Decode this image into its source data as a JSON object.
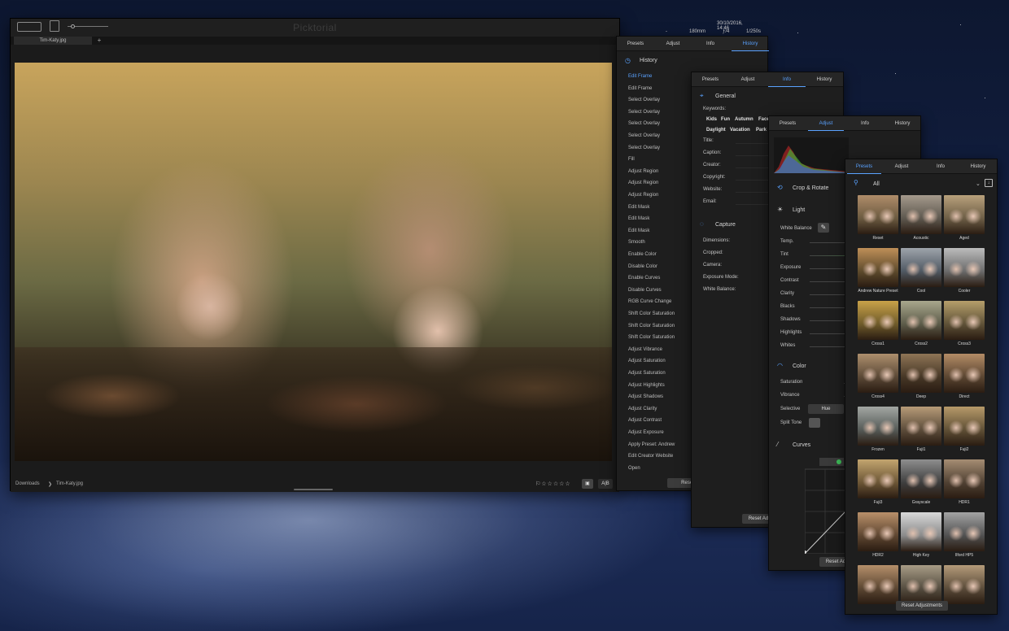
{
  "app": {
    "title": "Picktorial",
    "date": "30/10/2016, 14:46",
    "focal_length": "180mm",
    "aperture": "ƒ/4",
    "shutter": "1/250s",
    "dash": "--",
    "file_tab": "Tim-Katy.jpg",
    "add_tab": "+"
  },
  "status": {
    "breadcrumb_folder": "Downloads",
    "breadcrumb_sep": "❯",
    "breadcrumb_file": "Tim-Katy.jpg",
    "rating": "☆☆☆☆☆",
    "ab_label": "A|B"
  },
  "history_panel": {
    "tabs": [
      "Presets",
      "Adjust",
      "Info",
      "History"
    ],
    "title": "History",
    "items": [
      "Edit Frame",
      "Edit Frame",
      "Select Overlay",
      "Select Overlay",
      "Select Overlay",
      "Select Overlay",
      "Select Overlay",
      "Fill",
      "Adjust Region",
      "Adjust Region",
      "Adjust Region",
      "Edit Mask",
      "Edit Mask",
      "Edit Mask",
      "Smooth",
      "Enable Color",
      "Disable Color",
      "Enable Curves",
      "Disable Curves",
      "RGB Curve Change",
      "Shift Color Saturation",
      "Shift Color Saturation",
      "Shift Color Saturation",
      "Adjust Vibrance",
      "Adjust Saturation",
      "Adjust Saturation",
      "Adjust Highlights",
      "Adjust Shadows",
      "Adjust Clarity",
      "Adjust Contrast",
      "Adjust Exposure",
      "Apply Preset: Andrew",
      "Edit Creator Website",
      "Open"
    ],
    "reset": "Reset Adj"
  },
  "info_panel": {
    "tabs": [
      "Presets",
      "Adjust",
      "Info",
      "History"
    ],
    "general_title": "General",
    "keywords_label": "Keywords:",
    "keywords_row1": [
      "Kids",
      "Fun",
      "Autumn",
      "Face"
    ],
    "keywords_row2": [
      "Daylight",
      "Vacation",
      "Park"
    ],
    "fields": [
      "Title:",
      "Caption:",
      "Creator:",
      "Copyright:",
      "Website:",
      "Email:"
    ],
    "capture_title": "Capture",
    "capture_fields": [
      "Dimensions:",
      "Cropped:",
      "Camera:",
      "Exposure Mode:",
      "White Balance:"
    ],
    "reset": "Reset Ad"
  },
  "adjust_panel": {
    "tabs": [
      "Presets",
      "Adjust",
      "Info",
      "History"
    ],
    "crop_title": "Crop & Rotate",
    "light_title": "Light",
    "white_balance": "White Balance",
    "light_rows": [
      "Temp.",
      "Tint",
      "Exposure",
      "Contrast",
      "Clarity",
      "Blacks",
      "Shadows",
      "Highlights",
      "Whites"
    ],
    "color_title": "Color",
    "color_rows": [
      "Saturation",
      "Vibrance"
    ],
    "selective": "Selective",
    "selective_value": "Hue",
    "split_tone": "Split Tone",
    "curves_title": "Curves",
    "reset": "Reset Ad"
  },
  "presets_panel": {
    "tabs": [
      "Presets",
      "Adjust",
      "Info",
      "History"
    ],
    "filter": "All",
    "presets": [
      {
        "name": "Reset",
        "c1": "#b08d6a",
        "c2": "#6b5a40"
      },
      {
        "name": "Acoustic",
        "c1": "#a59a8c",
        "c2": "#5d574e"
      },
      {
        "name": "Aged",
        "c1": "#b9a17c",
        "c2": "#6c5d45"
      },
      {
        "name": "Andrew Nature Preset",
        "c1": "#bf8f58",
        "c2": "#5d4a2c"
      },
      {
        "name": "Cool",
        "c1": "#9ea4ab",
        "c2": "#4f5862"
      },
      {
        "name": "Cooler",
        "c1": "#bcbcbc",
        "c2": "#6a6a6a"
      },
      {
        "name": "Cross1",
        "c1": "#c9a249",
        "c2": "#6e5a2a"
      },
      {
        "name": "Cross2",
        "c1": "#a9a78d",
        "c2": "#5c5b49"
      },
      {
        "name": "Cross3",
        "c1": "#b69f6b",
        "c2": "#5e5137"
      },
      {
        "name": "Cross4",
        "c1": "#ad8f6d",
        "c2": "#5a4836"
      },
      {
        "name": "Deep",
        "c1": "#8f7556",
        "c2": "#463726"
      },
      {
        "name": "Direct",
        "c1": "#b48c66",
        "c2": "#5a4531"
      },
      {
        "name": "Frozen",
        "c1": "#a3a7a3",
        "c2": "#555a57"
      },
      {
        "name": "Fuji1",
        "c1": "#b79b78",
        "c2": "#5c4c3a"
      },
      {
        "name": "Fuji2",
        "c1": "#b79a6a",
        "c2": "#5f4f35"
      },
      {
        "name": "Fuji3",
        "c1": "#c3a56f",
        "c2": "#6b5535"
      },
      {
        "name": "Grayscale",
        "c1": "#8e8e8e",
        "c2": "#3e3e3e"
      },
      {
        "name": "HDR1",
        "c1": "#a58d73",
        "c2": "#4f4032"
      },
      {
        "name": "HDR2",
        "c1": "#b9906a",
        "c2": "#5e4631"
      },
      {
        "name": "High Key",
        "c1": "#d8d8d8",
        "c2": "#8a8a8a"
      },
      {
        "name": "Ilford HP5",
        "c1": "#a3a3a3",
        "c2": "#505050"
      },
      {
        "name": "",
        "c1": "#b58f6a",
        "c2": "#5b4632"
      },
      {
        "name": "",
        "c1": "#a89c86",
        "c2": "#554d40"
      },
      {
        "name": "",
        "c1": "#b59b7a",
        "c2": "#5a4b39"
      }
    ],
    "reset": "Reset Adjustments"
  }
}
